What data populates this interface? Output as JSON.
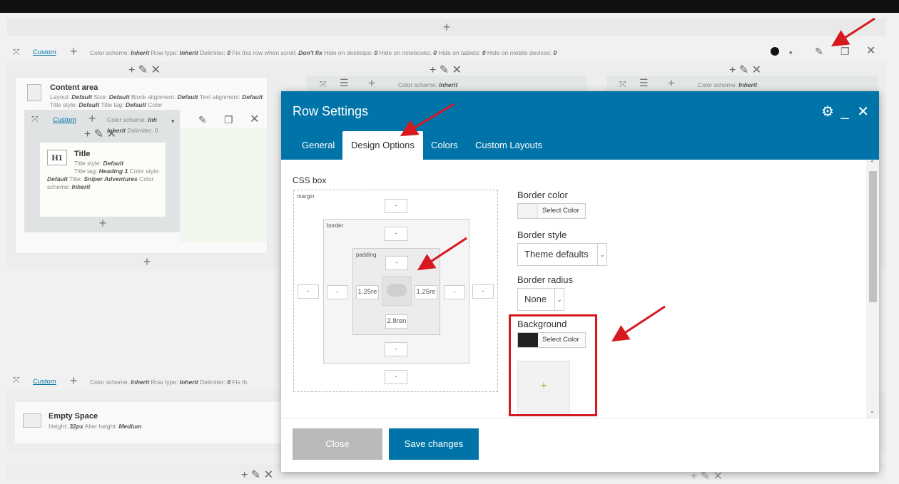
{
  "top_plus": "+",
  "row1": {
    "custom_label": "Custom",
    "plus": "+",
    "meta": [
      {
        "k": "Color scheme:",
        "v": "Inherit"
      },
      {
        "k": "Row type:",
        "v": "Inherit"
      },
      {
        "k": "Delimiter:",
        "v": "0"
      },
      {
        "k": "Fix this row when scroll:",
        "v": "Don't fix"
      },
      {
        "k": "Hide on desktops:",
        "v": "0"
      },
      {
        "k": "Hide on notebooks:",
        "v": "0"
      },
      {
        "k": "Hide on tablets:",
        "v": "0"
      },
      {
        "k": "Hide on mobile devices:",
        "v": "0"
      }
    ]
  },
  "content_area": {
    "title": "Content area",
    "lines": [
      {
        "k": "Layout:",
        "v": "Default"
      },
      {
        "k": "Size:",
        "v": "Default"
      },
      {
        "k": "Block alignment:",
        "v": "Default"
      },
      {
        "k": "Text alignment:",
        "v": "Default"
      },
      {
        "k": "Title style:",
        "v": "Default"
      },
      {
        "k": "Title tag:",
        "v": "Default"
      },
      {
        "k": "Color",
        "v": ""
      }
    ]
  },
  "inner_row": {
    "custom_label": "Custom",
    "plus": "+",
    "meta1": {
      "k": "Color scheme:",
      "v": "Inh"
    },
    "meta2": {
      "k": "Inherit",
      "v": "Delimiter: 0"
    }
  },
  "title_el": {
    "heading_icon": "H1",
    "title": "Title",
    "lines": [
      {
        "k": "Title style:",
        "v": "Default"
      },
      {
        "k": "Title tag:",
        "v": "Heading 1"
      },
      {
        "k": "Color style:",
        "v": "Default"
      },
      {
        "k": "Title:",
        "v": "Sniper Adventures"
      },
      {
        "k": "Color scheme:",
        "v": "Inherit"
      }
    ]
  },
  "col2_meta": {
    "k": "Color scheme:",
    "v": "Inherit"
  },
  "col3_meta": {
    "k": "Color scheme:",
    "v": "Inherit"
  },
  "row2": {
    "custom_label": "Custom",
    "meta": {
      "k": "Color scheme:",
      "v": "Inherit"
    },
    "meta2": {
      "k": "Row type:",
      "v": "Inherit"
    },
    "meta3": {
      "k": "Delimiter:",
      "v": "0"
    },
    "meta4": "Fix th"
  },
  "empty_space": {
    "title": "Empty Space",
    "line1": {
      "k": "Height:",
      "v": "32px"
    },
    "line2": {
      "k": "Alter height:",
      "v": "Medium"
    }
  },
  "modal": {
    "title": "Row Settings",
    "tabs": [
      "General",
      "Design Options",
      "Colors",
      "Custom Layouts"
    ],
    "active_tab": 1,
    "css_box_label": "CSS box",
    "margin_label": "margin",
    "border_label": "border",
    "padding_label": "padding",
    "margin_top": "-",
    "margin_left": "-",
    "margin_right": "-",
    "margin_bottom": "-",
    "border_top": "-",
    "border_left": "-",
    "border_right": "-",
    "border_bottom": "-",
    "padding_top": "-",
    "padding_left": "1.25re",
    "padding_right": "1.25re",
    "padding_bottom": "2.8ren",
    "border_color_label": "Border color",
    "select_color": "Select Color",
    "border_style_label": "Border style",
    "border_style_value": "Theme defaults",
    "border_radius_label": "Border radius",
    "border_radius_value": "None",
    "background_label": "Background",
    "background_color": "#222222",
    "add_image": "+",
    "close_label": "Close",
    "save_label": "Save changes"
  },
  "colors": {
    "accent": "#0074a8",
    "highlight": "#d6181f"
  }
}
